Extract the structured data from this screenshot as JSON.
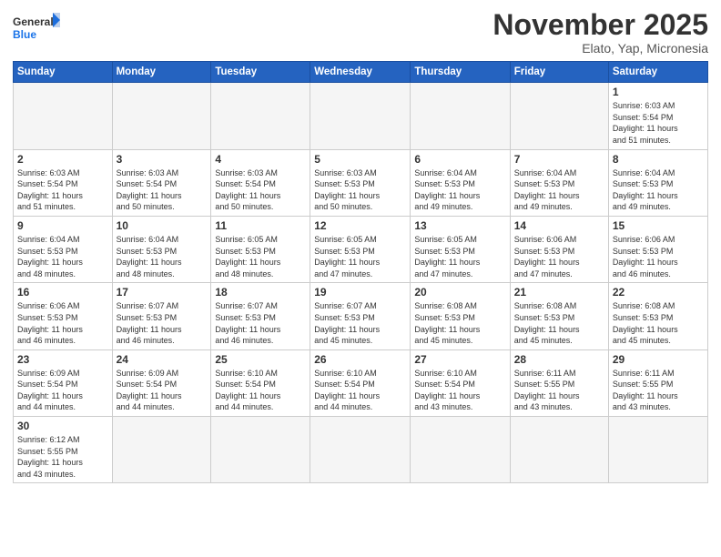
{
  "logo": {
    "general": "General",
    "blue": "Blue"
  },
  "header": {
    "month_year": "November 2025",
    "location": "Elato, Yap, Micronesia"
  },
  "days_of_week": [
    "Sunday",
    "Monday",
    "Tuesday",
    "Wednesday",
    "Thursday",
    "Friday",
    "Saturday"
  ],
  "weeks": [
    [
      {
        "day": "",
        "info": ""
      },
      {
        "day": "",
        "info": ""
      },
      {
        "day": "",
        "info": ""
      },
      {
        "day": "",
        "info": ""
      },
      {
        "day": "",
        "info": ""
      },
      {
        "day": "",
        "info": ""
      },
      {
        "day": "1",
        "info": "Sunrise: 6:03 AM\nSunset: 5:54 PM\nDaylight: 11 hours\nand 51 minutes."
      }
    ],
    [
      {
        "day": "2",
        "info": "Sunrise: 6:03 AM\nSunset: 5:54 PM\nDaylight: 11 hours\nand 51 minutes."
      },
      {
        "day": "3",
        "info": "Sunrise: 6:03 AM\nSunset: 5:54 PM\nDaylight: 11 hours\nand 50 minutes."
      },
      {
        "day": "4",
        "info": "Sunrise: 6:03 AM\nSunset: 5:54 PM\nDaylight: 11 hours\nand 50 minutes."
      },
      {
        "day": "5",
        "info": "Sunrise: 6:03 AM\nSunset: 5:53 PM\nDaylight: 11 hours\nand 50 minutes."
      },
      {
        "day": "6",
        "info": "Sunrise: 6:04 AM\nSunset: 5:53 PM\nDaylight: 11 hours\nand 49 minutes."
      },
      {
        "day": "7",
        "info": "Sunrise: 6:04 AM\nSunset: 5:53 PM\nDaylight: 11 hours\nand 49 minutes."
      },
      {
        "day": "8",
        "info": "Sunrise: 6:04 AM\nSunset: 5:53 PM\nDaylight: 11 hours\nand 49 minutes."
      }
    ],
    [
      {
        "day": "9",
        "info": "Sunrise: 6:04 AM\nSunset: 5:53 PM\nDaylight: 11 hours\nand 48 minutes."
      },
      {
        "day": "10",
        "info": "Sunrise: 6:04 AM\nSunset: 5:53 PM\nDaylight: 11 hours\nand 48 minutes."
      },
      {
        "day": "11",
        "info": "Sunrise: 6:05 AM\nSunset: 5:53 PM\nDaylight: 11 hours\nand 48 minutes."
      },
      {
        "day": "12",
        "info": "Sunrise: 6:05 AM\nSunset: 5:53 PM\nDaylight: 11 hours\nand 47 minutes."
      },
      {
        "day": "13",
        "info": "Sunrise: 6:05 AM\nSunset: 5:53 PM\nDaylight: 11 hours\nand 47 minutes."
      },
      {
        "day": "14",
        "info": "Sunrise: 6:06 AM\nSunset: 5:53 PM\nDaylight: 11 hours\nand 47 minutes."
      },
      {
        "day": "15",
        "info": "Sunrise: 6:06 AM\nSunset: 5:53 PM\nDaylight: 11 hours\nand 46 minutes."
      }
    ],
    [
      {
        "day": "16",
        "info": "Sunrise: 6:06 AM\nSunset: 5:53 PM\nDaylight: 11 hours\nand 46 minutes."
      },
      {
        "day": "17",
        "info": "Sunrise: 6:07 AM\nSunset: 5:53 PM\nDaylight: 11 hours\nand 46 minutes."
      },
      {
        "day": "18",
        "info": "Sunrise: 6:07 AM\nSunset: 5:53 PM\nDaylight: 11 hours\nand 46 minutes."
      },
      {
        "day": "19",
        "info": "Sunrise: 6:07 AM\nSunset: 5:53 PM\nDaylight: 11 hours\nand 45 minutes."
      },
      {
        "day": "20",
        "info": "Sunrise: 6:08 AM\nSunset: 5:53 PM\nDaylight: 11 hours\nand 45 minutes."
      },
      {
        "day": "21",
        "info": "Sunrise: 6:08 AM\nSunset: 5:53 PM\nDaylight: 11 hours\nand 45 minutes."
      },
      {
        "day": "22",
        "info": "Sunrise: 6:08 AM\nSunset: 5:53 PM\nDaylight: 11 hours\nand 45 minutes."
      }
    ],
    [
      {
        "day": "23",
        "info": "Sunrise: 6:09 AM\nSunset: 5:54 PM\nDaylight: 11 hours\nand 44 minutes."
      },
      {
        "day": "24",
        "info": "Sunrise: 6:09 AM\nSunset: 5:54 PM\nDaylight: 11 hours\nand 44 minutes."
      },
      {
        "day": "25",
        "info": "Sunrise: 6:10 AM\nSunset: 5:54 PM\nDaylight: 11 hours\nand 44 minutes."
      },
      {
        "day": "26",
        "info": "Sunrise: 6:10 AM\nSunset: 5:54 PM\nDaylight: 11 hours\nand 44 minutes."
      },
      {
        "day": "27",
        "info": "Sunrise: 6:10 AM\nSunset: 5:54 PM\nDaylight: 11 hours\nand 43 minutes."
      },
      {
        "day": "28",
        "info": "Sunrise: 6:11 AM\nSunset: 5:55 PM\nDaylight: 11 hours\nand 43 minutes."
      },
      {
        "day": "29",
        "info": "Sunrise: 6:11 AM\nSunset: 5:55 PM\nDaylight: 11 hours\nand 43 minutes."
      }
    ],
    [
      {
        "day": "30",
        "info": "Sunrise: 6:12 AM\nSunset: 5:55 PM\nDaylight: 11 hours\nand 43 minutes."
      },
      {
        "day": "",
        "info": ""
      },
      {
        "day": "",
        "info": ""
      },
      {
        "day": "",
        "info": ""
      },
      {
        "day": "",
        "info": ""
      },
      {
        "day": "",
        "info": ""
      },
      {
        "day": "",
        "info": ""
      }
    ]
  ]
}
